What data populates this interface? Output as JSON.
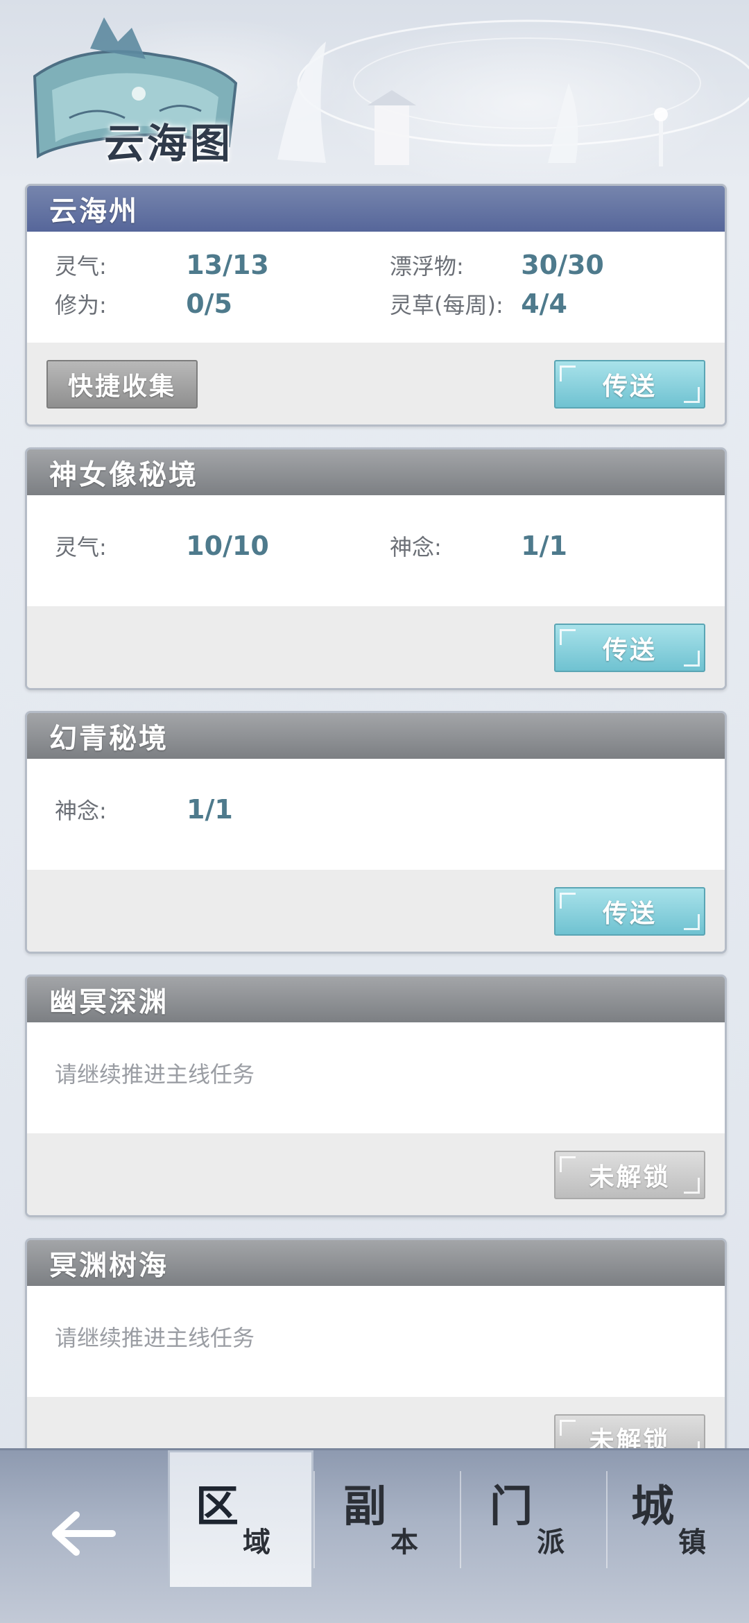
{
  "header": {
    "title": "云海图"
  },
  "cards": [
    {
      "title": "云海州",
      "stats": [
        {
          "label": "灵气:",
          "value": "13/13",
          "label2": "漂浮物:",
          "value2": "30/30"
        },
        {
          "label": "修为:",
          "value": "0/5",
          "label2": "灵草(每周):",
          "value2": "4/4"
        }
      ],
      "left_button": "快捷收集",
      "right_button": "传送"
    },
    {
      "title": "神女像秘境",
      "stats": [
        {
          "label": "灵气:",
          "value": "10/10",
          "label2": "神念:",
          "value2": "1/1"
        }
      ],
      "right_button": "传送"
    },
    {
      "title": "幻青秘境",
      "stats": [
        {
          "label": "神念:",
          "value": "1/1"
        }
      ],
      "right_button": "传送"
    },
    {
      "title": "幽冥深渊",
      "notice": "请继续推进主线任务",
      "right_button": "未解锁"
    },
    {
      "title": "冥渊树海",
      "notice": "请继续推进主线任务",
      "right_button": "未解锁"
    }
  ],
  "bottom_nav": {
    "tabs": [
      {
        "big": "区",
        "small": "域"
      },
      {
        "big": "副",
        "small": "本"
      },
      {
        "big": "门",
        "small": "派"
      },
      {
        "big": "城",
        "small": "镇"
      }
    ],
    "selected_index": 0
  },
  "colors": {
    "active_header": "#5f6f9a",
    "muted_header": "#8a8d91",
    "teleport_button": "#6fc2d1",
    "value_text": "#4e7a8c"
  },
  "icons": {
    "back": "arrow-left-icon"
  }
}
